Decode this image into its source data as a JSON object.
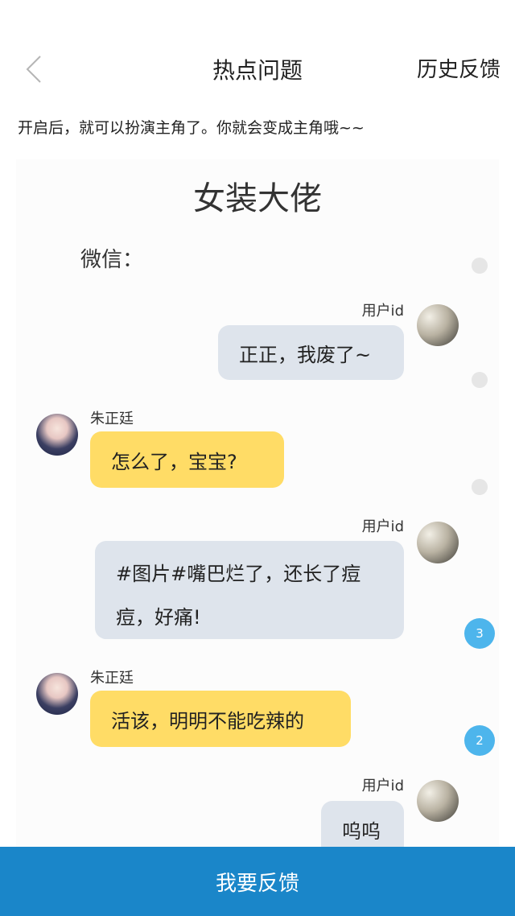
{
  "nav": {
    "title": "热点问题",
    "right_label": "历史反馈",
    "back_icon": "chevron-left-icon"
  },
  "description": "开启后，就可以扮演主角了。你就会变成主角哦~~",
  "card": {
    "title": "女装大佬",
    "subtitle": "微信："
  },
  "messages": [
    {
      "side": "right",
      "name": "用户id",
      "text": "正正，我废了~"
    },
    {
      "side": "left",
      "name": "朱正廷",
      "text": "怎么了，宝宝?"
    },
    {
      "side": "right",
      "name": "用户id",
      "text": "#图片#嘴巴烂了，还长了痘痘，好痛!"
    },
    {
      "side": "left",
      "name": "朱正廷",
      "text": "活该，明明不能吃辣的"
    },
    {
      "side": "right",
      "name": "用户id",
      "text": "呜呜"
    }
  ],
  "badges": [
    "3",
    "2"
  ],
  "footer": {
    "label": "我要反馈"
  },
  "colors": {
    "accent": "#1a86c9",
    "badge": "#4db5ec",
    "bubble_me": "#dee4ec",
    "bubble_other": "#ffdc66"
  }
}
